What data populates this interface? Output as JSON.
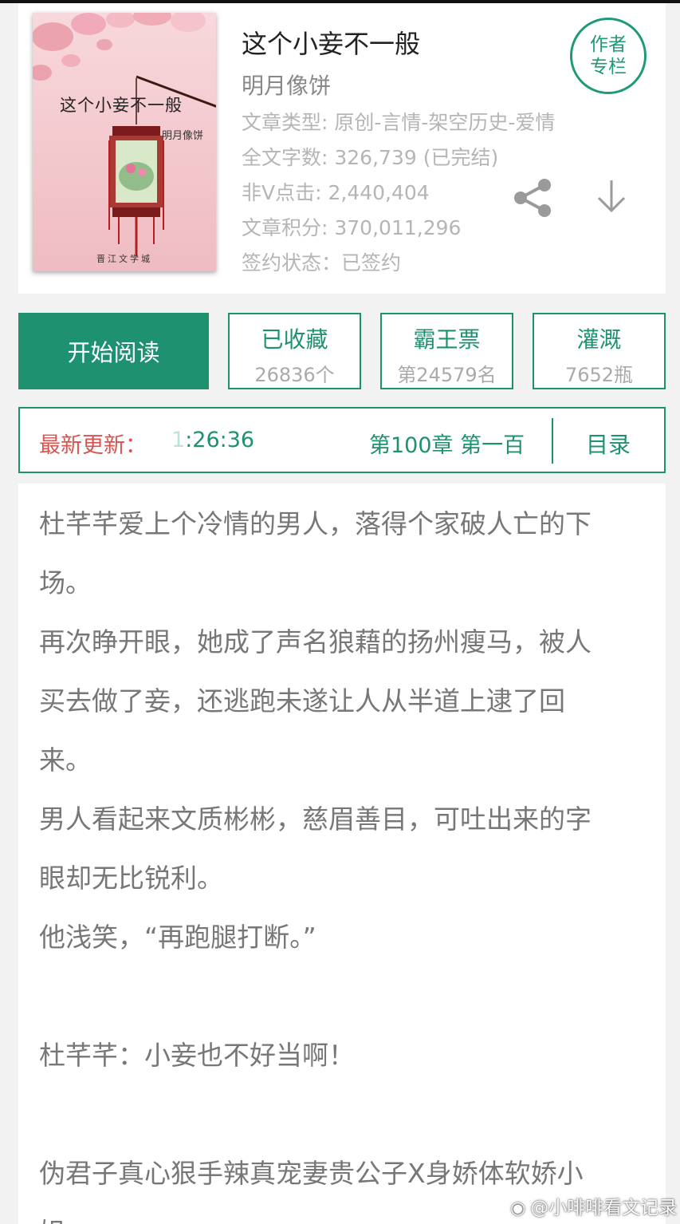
{
  "book": {
    "title": "这个小妾不一般",
    "author": "明月像饼",
    "cover": {
      "title": "这个小妾不一般",
      "author": "明月像饼",
      "publisher": "晋江文学城"
    },
    "info": [
      "文章类型: 原创-言情-架空历史-爱情",
      "全文字数: 326,739 (已完结)",
      "非Ⅴ点击: 2,440,404",
      "文章积分: 370,011,296",
      "签约状态：已签约"
    ],
    "author_column": [
      "作者",
      "专栏"
    ]
  },
  "icons": {
    "share": "share-icon",
    "download": "download-arrow-icon"
  },
  "actions": {
    "read_label": "开始阅读",
    "favorite": {
      "label": "已收藏",
      "value": "26836个"
    },
    "vote": {
      "label": "霸王票",
      "value": "第24579名"
    },
    "nutrient": {
      "label": "灌溉",
      "value": "7652瓶"
    }
  },
  "update": {
    "label": "最新更新：",
    "time_prefix": "1",
    "time": ":26:36",
    "chapter": "第100章  第一百",
    "toc_label": "目录"
  },
  "synopsis": [
    "杜芊芊爱上个冷情的男人，落得个家破人亡的下",
    "场。",
    "再次睁开眼，她成了声名狼藉的扬州瘦马，被人",
    "买去做了妾，还逃跑未遂让人从半道上逮了回",
    "来。",
    "男人看起来文质彬彬，慈眉善目，可吐出来的字",
    "眼却无比锐利。",
    "他浅笑，“再跑腿打断。”",
    "",
    "杜芊芊：小妾也不好当啊！",
    "",
    "伪君子真心狠手辣真宠妻贵公子X身娇体软娇小",
    "姐"
  ],
  "watermark": "@小啡啡看文记录",
  "colors": {
    "accent": "#1d9170",
    "update_label": "#d9534f",
    "muted_text": "#b5b5b5"
  }
}
